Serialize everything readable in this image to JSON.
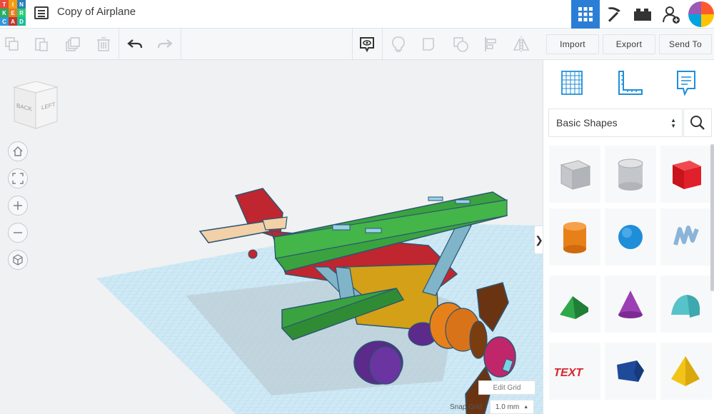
{
  "app": {
    "logo_letters": [
      "T",
      "I",
      "N",
      "K",
      "E",
      "R",
      "C",
      "A",
      "D"
    ],
    "logo_colors": [
      "#e74c3c",
      "#f39c12",
      "#2980b9",
      "#27ae60",
      "#e67e22",
      "#2ecc71",
      "#3498db",
      "#c0392b",
      "#1abc9c"
    ],
    "document_title": "Copy of Airplane"
  },
  "top_right": {
    "buttons": [
      "3d-view-icon",
      "pickaxe-icon",
      "bricks-icon",
      "add-user-icon"
    ],
    "active_color": "#2b7ed6"
  },
  "toolbar": {
    "icons": [
      "copy-icon",
      "paste-icon",
      "duplicate-icon",
      "delete-icon",
      "undo-icon",
      "redo-icon",
      "notes-icon",
      "bulb-icon",
      "group-icon",
      "ungroup-icon",
      "align-icon",
      "mirror-icon"
    ]
  },
  "actions": {
    "import_label": "Import",
    "export_label": "Export",
    "send_to_label": "Send To"
  },
  "viewcube": {
    "face_left": "BACK",
    "face_right": "LEFT"
  },
  "workplane": {
    "edit_grid_label": "Edit Grid",
    "snap_grid_label": "Snap Grid",
    "snap_grid_value": "1.0 mm",
    "grid_color": "#8ecae6",
    "collapse_glyph": "❯"
  },
  "panel": {
    "tools": [
      "workplane-icon",
      "ruler-icon",
      "notes-icon"
    ],
    "category": "Basic Shapes",
    "shapes": [
      {
        "name": "box-hole",
        "color": "#b9bcc0"
      },
      {
        "name": "cylinder-hole",
        "color": "#b9bcc0"
      },
      {
        "name": "box",
        "color": "#e0202a"
      },
      {
        "name": "cylinder",
        "color": "#e8801a"
      },
      {
        "name": "sphere",
        "color": "#1f8ed8"
      },
      {
        "name": "scribble",
        "color": "#8ab4d8"
      },
      {
        "name": "roof",
        "color": "#2fa84a"
      },
      {
        "name": "cone",
        "color": "#9b3fb3"
      },
      {
        "name": "round-roof",
        "color": "#56c3c9"
      },
      {
        "name": "text",
        "color": "#d8262d"
      },
      {
        "name": "polygon",
        "color": "#1f4a9a"
      },
      {
        "name": "pyramid",
        "color": "#f2c418"
      }
    ]
  }
}
